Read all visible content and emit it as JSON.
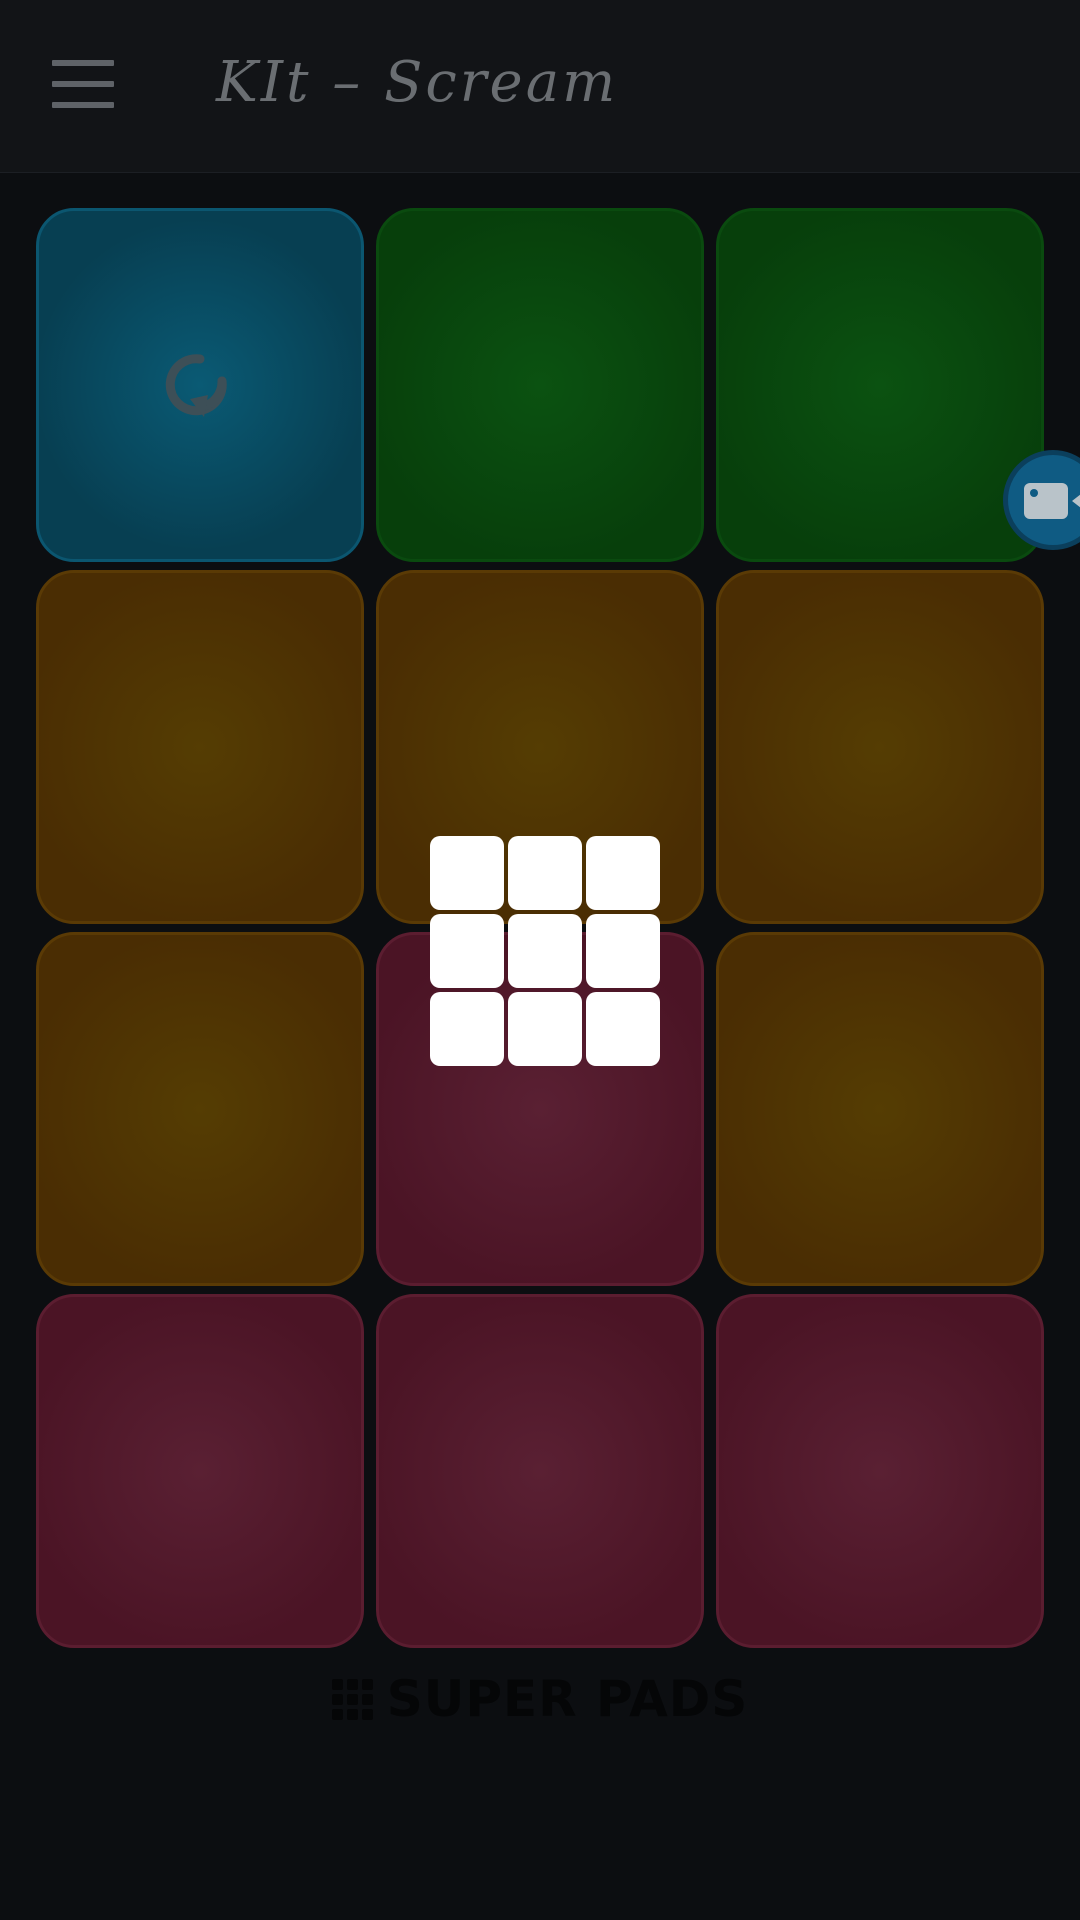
{
  "header": {
    "title": "KIt – Scream",
    "menu_icon": "hamburger-menu-icon"
  },
  "pads": [
    {
      "color": "blue",
      "icon": "loop-icon"
    },
    {
      "color": "green"
    },
    {
      "color": "green"
    },
    {
      "color": "orange"
    },
    {
      "color": "orange"
    },
    {
      "color": "orange"
    },
    {
      "color": "orange"
    },
    {
      "color": "red"
    },
    {
      "color": "orange"
    },
    {
      "color": "red"
    },
    {
      "color": "red"
    },
    {
      "color": "red"
    }
  ],
  "record_button": {
    "icon": "video-camera-icon",
    "color": "#0f5b83"
  },
  "overlay": {
    "icon": "pad-grid-icon",
    "color": "#ffffff"
  },
  "footer": {
    "brand": "SUPER PADS",
    "icon": "grid-dots-icon"
  },
  "colors": {
    "background": "#0c0e11",
    "blue_pad": "#073f52",
    "green_pad": "#073f0b",
    "orange_pad": "#4a2d03",
    "red_pad": "#4b1425"
  }
}
